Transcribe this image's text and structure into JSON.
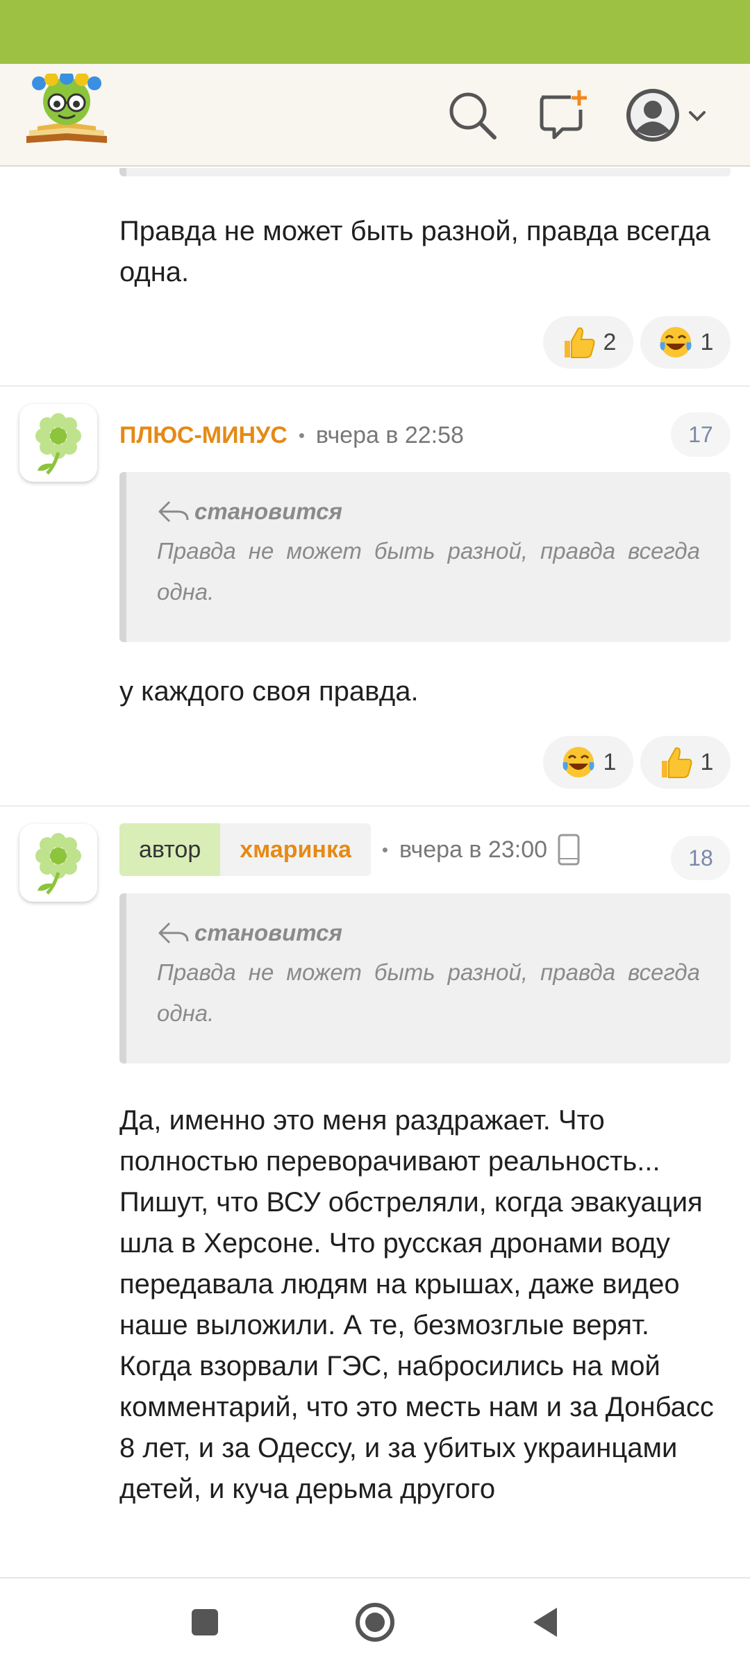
{
  "comments": [
    {
      "text": "Правда не может быть разной, правда всегда одна.",
      "reactions": [
        {
          "icon": "thumbs-up-emoji",
          "count": "2"
        },
        {
          "icon": "tears-of-joy-emoji",
          "count": "1"
        }
      ]
    },
    {
      "author": "ПЛЮС-МИНУС",
      "time": "вчера в 22:58",
      "number": "17",
      "quote": {
        "author": "становится",
        "text": "Правда не может быть разной, правда всегда одна."
      },
      "text": "у каждого своя правда.",
      "reactions": [
        {
          "icon": "tears-of-joy-emoji",
          "count": "1"
        },
        {
          "icon": "thumbs-up-emoji",
          "count": "1"
        }
      ]
    },
    {
      "author_role": "автор",
      "author": "хмаринка",
      "time": "вчера в 23:00",
      "number": "18",
      "quote": {
        "author": "становится",
        "text": "Правда не может быть разной, правда всегда одна."
      },
      "paragraphs": [
        "Да, именно это меня раздражает. Что полностью переворачивают реальность... Пишут, что ВСУ обстреляли, когда эвакуация шла в Херсоне. Что русская дронами воду передавала людям на крышах, даже видео наше выложили. А те, безмозглые верят.",
        "Когда взорвали ГЭС, набросились на мой комментарий, что это месть нам и за Донбасс 8 лет, и за Одессу, и за убитых украинцами детей, и куча дерьма другого"
      ]
    }
  ],
  "colors": {
    "status_bar": "#9dc143",
    "author": "#e58a16",
    "author_tag": "#d9edb7",
    "header": "#f8f6ef"
  }
}
